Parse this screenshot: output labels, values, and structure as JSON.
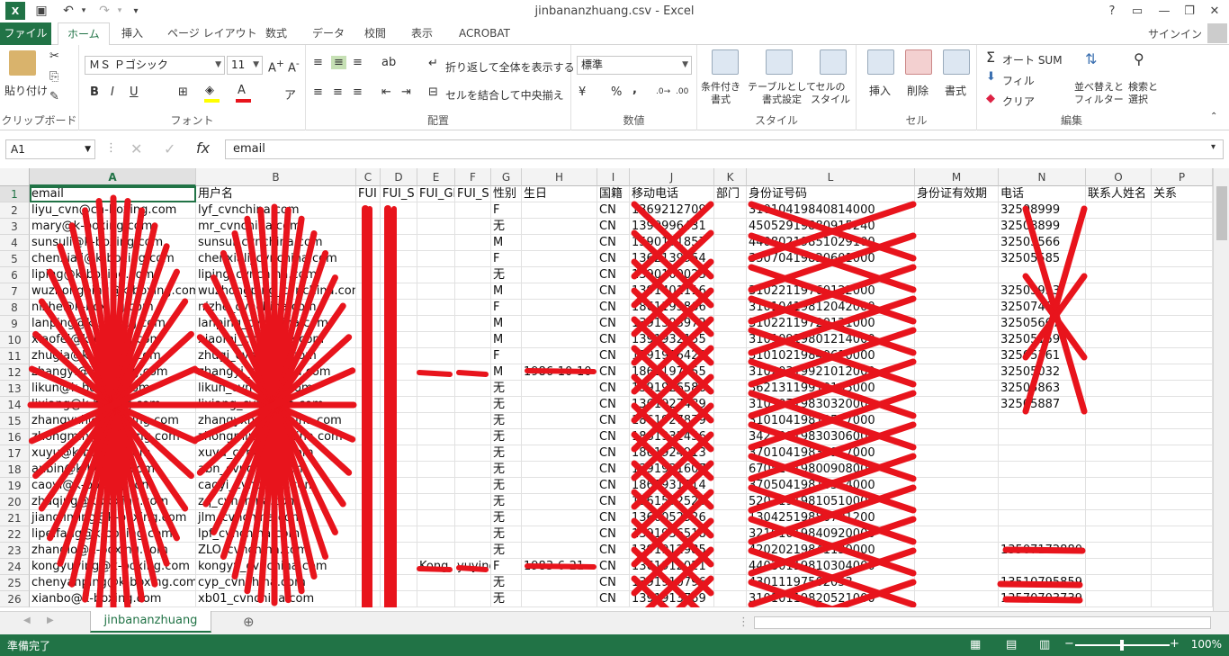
{
  "window": {
    "title": "jinbananzhuang.csv - Excel",
    "help": "?",
    "minimize": "—",
    "restore": "❐",
    "close": "✕"
  },
  "quick_access": {
    "undo": "↶",
    "redo": "↷",
    "customize": "▾"
  },
  "tabs": {
    "file": "ファイル",
    "items": [
      "ホーム",
      "挿入",
      "ページ レイアウト",
      "数式",
      "データ",
      "校閲",
      "表示",
      "ACROBAT"
    ],
    "signin": "サインイン"
  },
  "ribbon": {
    "clipboard": {
      "label": "クリップボード",
      "paste": "貼り付け"
    },
    "font": {
      "label": "フォント",
      "name": "ＭＳ Ｐゴシック",
      "size": "11",
      "bold": "B",
      "italic": "I",
      "underline": "U"
    },
    "alignment": {
      "label": "配置",
      "wrap": "折り返して全体を表示する",
      "merge": "セルを結合して中央揃え"
    },
    "number": {
      "label": "数値",
      "format": "標準",
      "percent": "%",
      "comma": ","
    },
    "styles": {
      "label": "スタイル",
      "conditional": "条件付き\n書式",
      "table": "テーブルとして\n書式設定",
      "cell": "セルの\nスタイル"
    },
    "cells": {
      "label": "セル",
      "insert": "挿入",
      "delete": "削除",
      "format": "書式"
    },
    "editing": {
      "label": "編集",
      "autosum": "オート SUM",
      "fill": "フィル",
      "clear": "クリア",
      "sort": "並べ替えと\nフィルター",
      "find": "検索と\n選択"
    }
  },
  "formula_bar": {
    "name_box": "A1",
    "content": "email"
  },
  "columns": [
    "A",
    "B",
    "C",
    "D",
    "E",
    "F",
    "G",
    "H",
    "I",
    "J",
    "K",
    "L",
    "M",
    "N",
    "O",
    "P"
  ],
  "header_row": [
    "email",
    "用户名",
    "FUI",
    "FUI_S",
    "FUI_GI",
    "FUI_S",
    "性别",
    "生日",
    "国籍",
    "移动电话",
    "部门",
    "身份证号码",
    "身份证有效期",
    "电话",
    "联系人姓名",
    "关系"
  ],
  "rows": [
    {
      "n": "2",
      "a": "liyu_cvn@ch-boxing.com",
      "b": "lyf_cvnchina.com",
      "g": "F",
      "i": "CN",
      "j": "1369212709",
      "l": "31010419840814000",
      "n2": "32508999"
    },
    {
      "n": "3",
      "a": "mary@k-boxing.com",
      "b": "mr_cvnchina.com",
      "g": "无",
      "i": "CN",
      "j": "1390996431",
      "l": "45052919880915240",
      "n2": "32508899"
    },
    {
      "n": "4",
      "a": "sunsuli@k-boxing.com",
      "b": "sunsui_cvnchina.com",
      "g": "M",
      "i": "CN",
      "j": "1590191857",
      "l": "44080219851029100",
      "n2": "32505566"
    },
    {
      "n": "5",
      "a": "chenxiali@k-boxing.com",
      "b": "chenxiali_cvnchina.com",
      "g": "F",
      "i": "CN",
      "j": "1362139954",
      "l": "35070419820601000",
      "n2": "32505585"
    },
    {
      "n": "6",
      "a": "liping@k-boxing.com",
      "b": "liping_cvnchina.com",
      "g": "无",
      "i": "CN",
      "j": "1390100023",
      "l": "",
      "n2": ""
    },
    {
      "n": "7",
      "a": "wuzhongping@k-boxing.com",
      "b": "wuzhongping_cvnchina.com",
      "g": "M",
      "i": "CN",
      "j": "1391401116",
      "l": "31022119760122000",
      "n2": "32505933"
    },
    {
      "n": "8",
      "a": "nizhe@k-boxing.com",
      "b": "nizhe_cvnchina.com",
      "g": "F",
      "i": "CN",
      "j": "1861193866",
      "l": "31010419812042000",
      "n2": "32507450"
    },
    {
      "n": "9",
      "a": "lanping@k-boxing.com",
      "b": "lanping_cvnchina.com",
      "g": "M",
      "i": "CN",
      "j": "1391393972",
      "l": "31022119720121000",
      "n2": "32505667"
    },
    {
      "n": "10",
      "a": "xiaofei@k-boxing.com",
      "b": "xiaofei_cvnchina.com",
      "g": "M",
      "i": "CN",
      "j": "1391932155",
      "l": "31010919801214000",
      "n2": "32505159"
    },
    {
      "n": "11",
      "a": "zhugia@k-boxing.com",
      "b": "zhugi_cvnchina.com",
      "g": "F",
      "i": "CN",
      "j": "1391916423",
      "l": "31010219840610000",
      "n2": "32505361"
    },
    {
      "n": "12",
      "a": "zhangyi@k-boxing.com",
      "b": "zhangyi_cvnchina.com",
      "g": "M",
      "h": "1986-10-10",
      "i": "CN",
      "j": "1862197755",
      "l": "31020319921012000",
      "n2": "32505032"
    },
    {
      "n": "13",
      "a": "likun@k-boxing.com",
      "b": "likun_cvnchina.com",
      "g": "无",
      "i": "CN",
      "j": "1391926588",
      "l": "36213119910105000",
      "n2": "32505863"
    },
    {
      "n": "14",
      "a": "lixiang@k-boxing.com",
      "b": "lixiang_cvnchina.com",
      "g": "无",
      "i": "CN",
      "j": "1361927489",
      "l": "31010719830320000",
      "n2": "32505887"
    },
    {
      "n": "15",
      "a": "zhangyxh@k-boxing.com",
      "b": "zhangyxh_cvnchina.com",
      "g": "无",
      "i": "CN",
      "j": "1861927879",
      "l": "31010419810527000",
      "n2": ""
    },
    {
      "n": "16",
      "a": "zhongmin@k-boxing.com",
      "b": "zhongmin_cvnchina.com",
      "g": "无",
      "i": "CN",
      "j": "1861932456",
      "l": "34220919830306000",
      "n2": ""
    },
    {
      "n": "17",
      "a": "xuyu@k-boxing.com",
      "b": "xuyu_cvnchina.com",
      "g": "无",
      "i": "CN",
      "j": "1861924913",
      "l": "37010419830917000",
      "n2": ""
    },
    {
      "n": "18",
      "a": "anbin@k-boxing.com",
      "b": "abn_cvnchina.com",
      "g": "无",
      "i": "CN",
      "j": "1391931607",
      "l": "67052419800908000",
      "n2": ""
    },
    {
      "n": "19",
      "a": "caoyi@k-boxing.com",
      "b": "caoyi_cvnchina.com",
      "g": "无",
      "i": "CN",
      "j": "1861931814",
      "l": "37050419810514000",
      "n2": ""
    },
    {
      "n": "20",
      "a": "zhaqing@k-boxing.com",
      "b": "zq_cvnchina.com",
      "g": "无",
      "i": "CN",
      "j": "1361592520",
      "l": "52031919810510000",
      "n2": ""
    },
    {
      "n": "21",
      "a": "jiangliming@k-boxing.com",
      "b": "jlm_cvnchina.com",
      "g": "无",
      "i": "CN",
      "j": "1360052526",
      "l": "13042519880701200",
      "n2": ""
    },
    {
      "n": "22",
      "a": "lipeifang@k-boxing.com",
      "b": "lpf_cvnchina.com",
      "g": "无",
      "i": "CN",
      "j": "1391936518",
      "l": "32101019840920000",
      "n2": ""
    },
    {
      "n": "23",
      "a": "zhanglo@k-boxing.com",
      "b": "ZLO_cvnchina.com",
      "g": "无",
      "i": "CN",
      "j": "1391912985",
      "l": "42020219841130000",
      "n2": "13507172880"
    },
    {
      "n": "24",
      "a": "kongyuying@k-boxing.com",
      "b": "kongyy_cvnchina.com",
      "e": "Kong",
      "f": "yuying",
      "g": "F",
      "h": "1983-6-21",
      "i": "CN",
      "j": "1361912021",
      "l": "44030119810304000",
      "n2": ""
    },
    {
      "n": "25",
      "a": "chenyanping@k-boxing.com",
      "b": "cyp_cvnchina.com",
      "g": "无",
      "i": "CN",
      "j": "1391910796",
      "l": "43011197502053",
      "k": "",
      "m": "",
      "n2": "13510795859"
    },
    {
      "n": "26",
      "a": "xianbo@k-boxing.com",
      "b": "xb01_cvnchina.com",
      "g": "无",
      "i": "CN",
      "j": "1391913769",
      "l": "31010119820521000",
      "n2": "13570703739"
    }
  ],
  "sheet_tab": "jinbananzhuang",
  "status": {
    "ready": "準備完了",
    "zoom": "100%"
  },
  "colors": {
    "accent": "#217346",
    "scribble": "#e8141c"
  }
}
